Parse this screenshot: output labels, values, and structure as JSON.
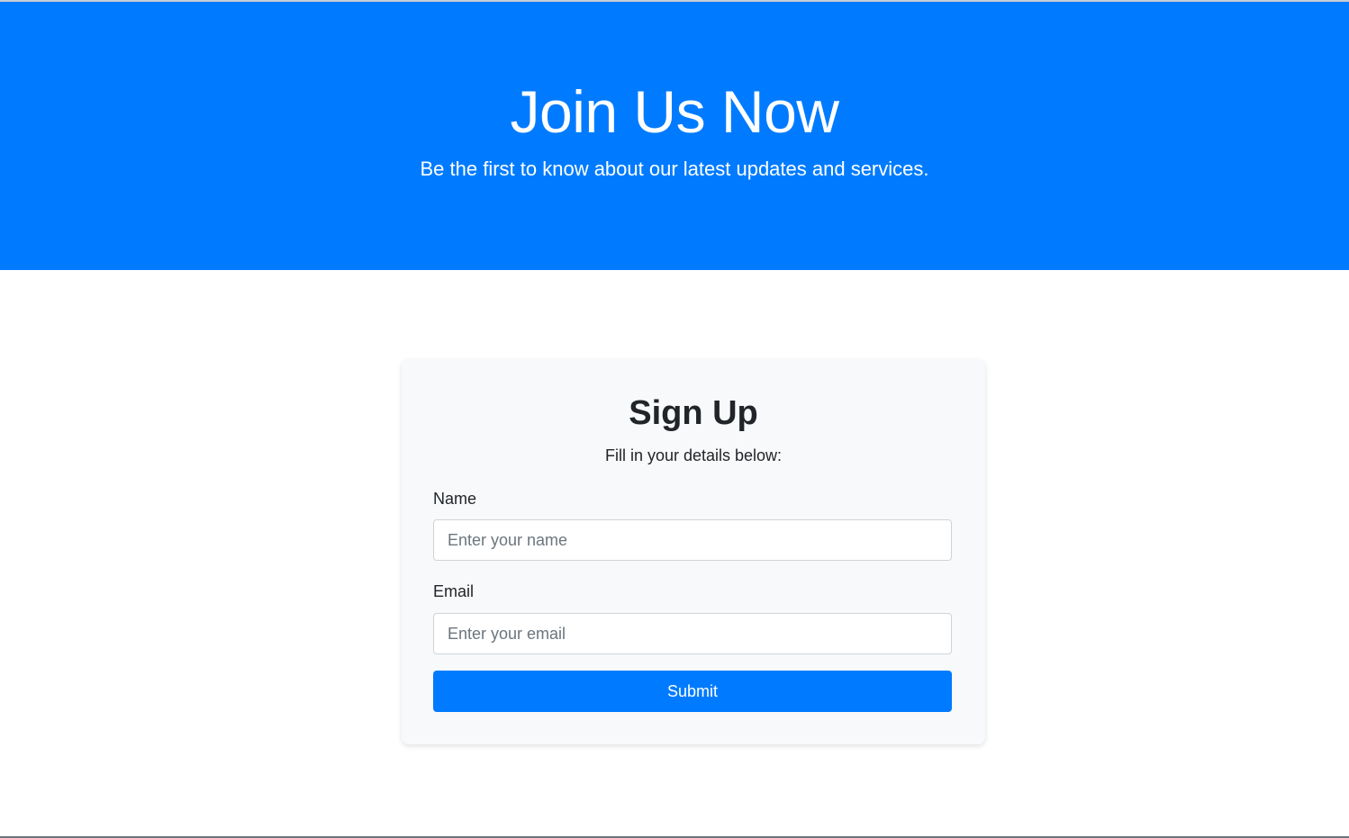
{
  "hero": {
    "title": "Join Us Now",
    "subtitle": "Be the first to know about our latest updates and services.",
    "background_color": "#007bff",
    "text_color": "#ffffff"
  },
  "signup_card": {
    "title": "Sign Up",
    "subtitle": "Fill in your details below:",
    "background_color": "#f8f9fa",
    "fields": {
      "name": {
        "label": "Name",
        "placeholder": "Enter your name",
        "value": ""
      },
      "email": {
        "label": "Email",
        "placeholder": "Enter your email",
        "value": ""
      }
    },
    "submit_label": "Submit",
    "submit_color": "#007bff"
  }
}
